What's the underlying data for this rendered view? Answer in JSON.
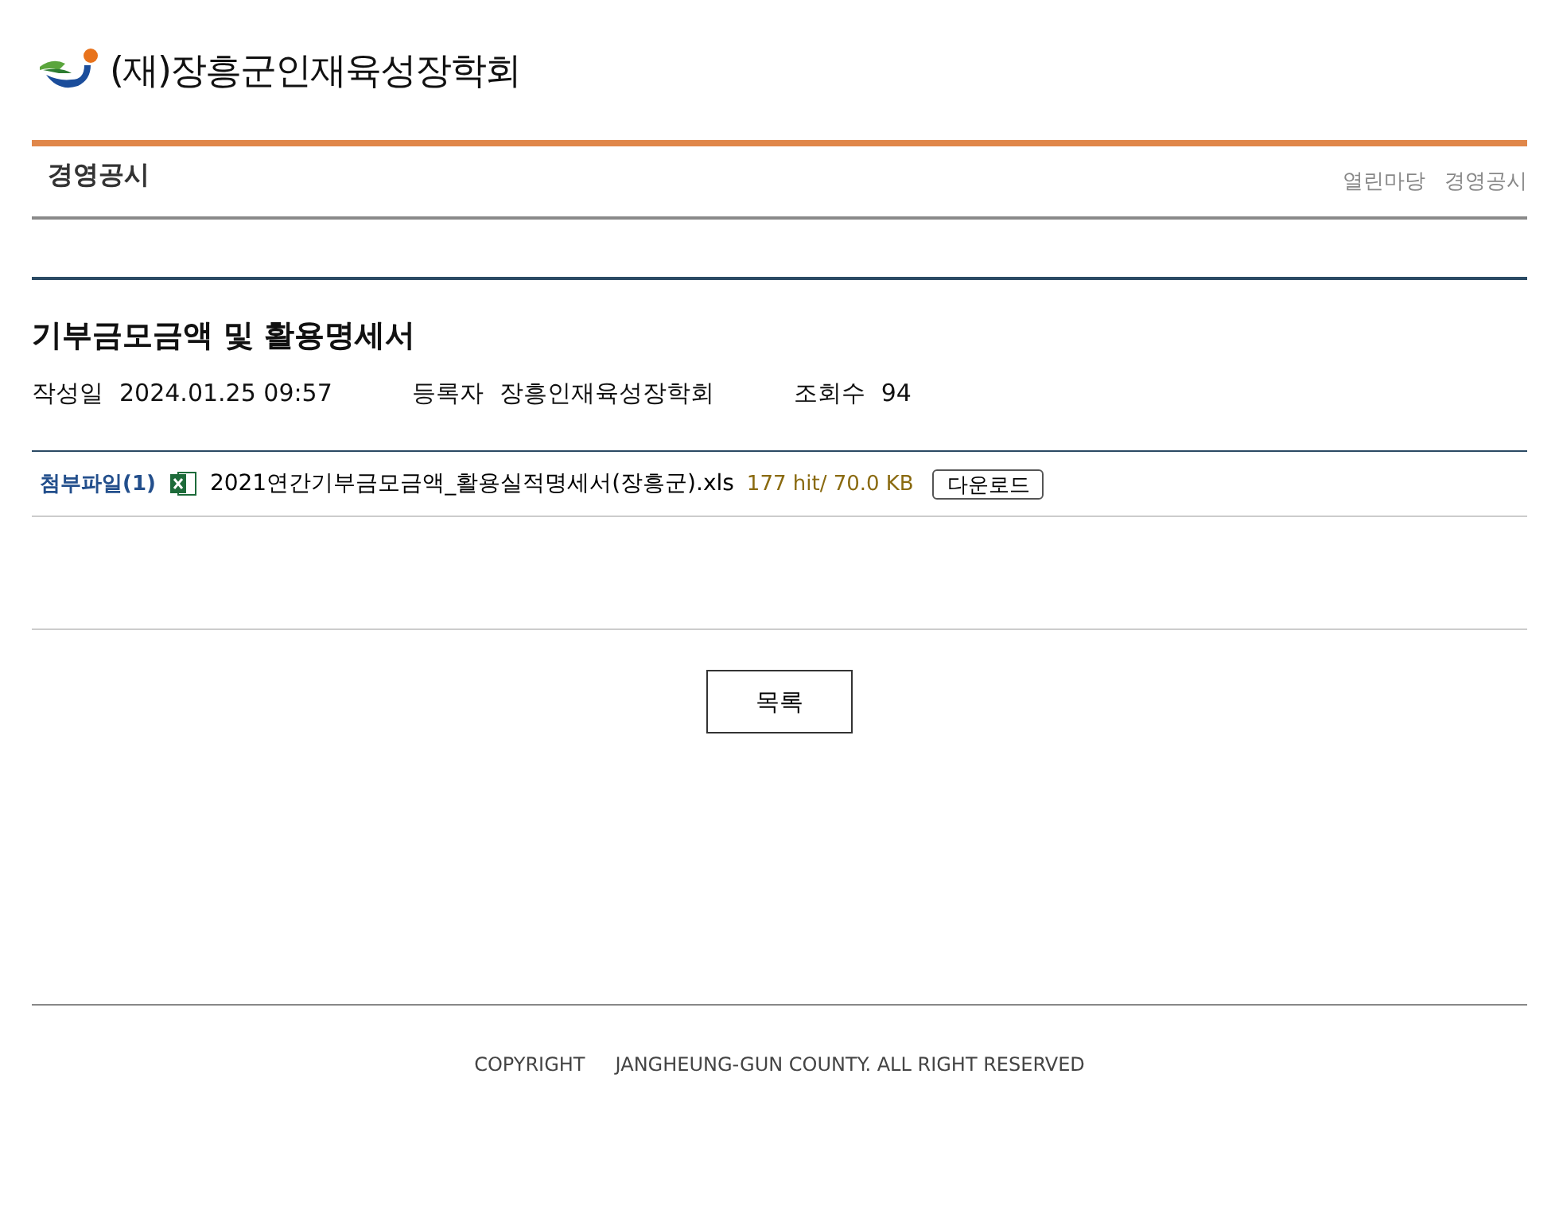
{
  "site_title": "(재)장흥군인재육성장학회",
  "section_title": "경영공시",
  "breadcrumb": [
    "열린마당",
    "경영공시"
  ],
  "post": {
    "title": "기부금모금액 및 활용명세서",
    "meta": [
      {
        "label": "작성일",
        "value": "2024.01.25 09:57"
      },
      {
        "label": "등록자",
        "value": "장흥인재육성장학회"
      },
      {
        "label": "조회수",
        "value": "94"
      }
    ],
    "attachment": {
      "label": "첨부파일(1)",
      "filename": "2021연간기부금모금액_활용실적명세서(장흥군).xls",
      "stats": "177 hit/ 70.0 KB",
      "button": "다운로드"
    }
  },
  "list_button": "목록",
  "footer": "COPYRIGHT     JANGHEUNG-GUN COUNTY. ALL RIGHT RESERVED"
}
